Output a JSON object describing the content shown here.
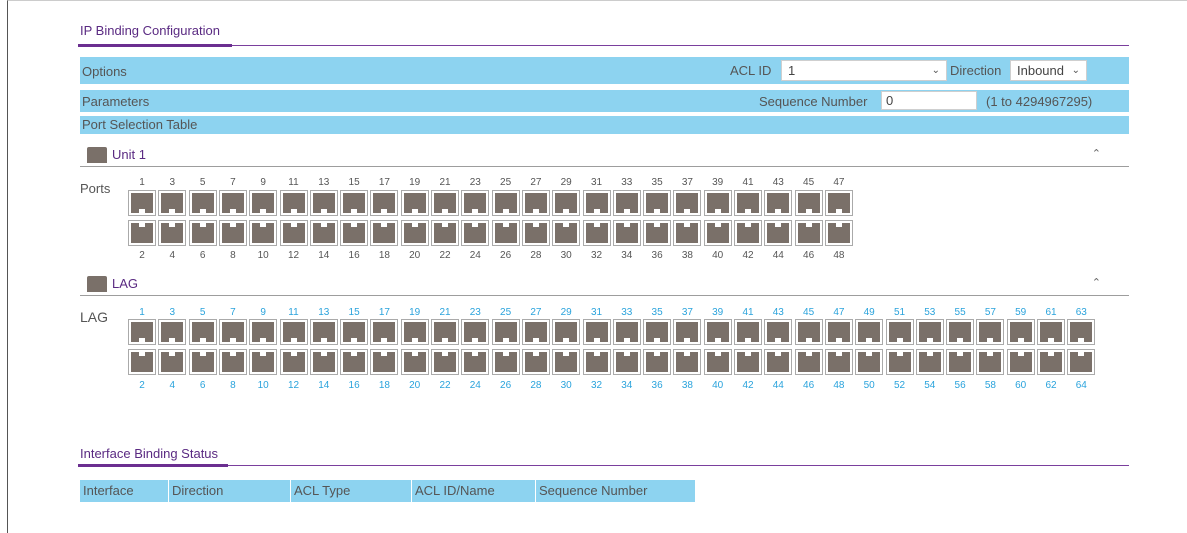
{
  "config_title": "IP Binding Configuration",
  "options": {
    "label": "Options",
    "acl_id_label": "ACL ID",
    "acl_id_value": "1",
    "direction_label": "Direction",
    "direction_value": "Inbound"
  },
  "parameters": {
    "label": "Parameters",
    "sequence_label": "Sequence Number",
    "sequence_value": "0",
    "sequence_range": "(1 to 4294967295)"
  },
  "port_selection_label": "Port Selection Table",
  "unit": {
    "label": "Unit 1",
    "ports_label": "Ports",
    "odd": [
      "1",
      "3",
      "5",
      "7",
      "9",
      "11",
      "13",
      "15",
      "17",
      "19",
      "21",
      "23",
      "25",
      "27",
      "29",
      "31",
      "33",
      "35",
      "37",
      "39",
      "41",
      "43",
      "45",
      "47"
    ],
    "even": [
      "2",
      "4",
      "6",
      "8",
      "10",
      "12",
      "14",
      "16",
      "18",
      "20",
      "22",
      "24",
      "26",
      "28",
      "30",
      "32",
      "34",
      "36",
      "38",
      "40",
      "42",
      "44",
      "46",
      "48"
    ]
  },
  "lag": {
    "label": "LAG",
    "row_label": "LAG",
    "odd": [
      "1",
      "3",
      "5",
      "7",
      "9",
      "11",
      "13",
      "15",
      "17",
      "19",
      "21",
      "23",
      "25",
      "27",
      "29",
      "31",
      "33",
      "35",
      "37",
      "39",
      "41",
      "43",
      "45",
      "47",
      "49",
      "51",
      "53",
      "55",
      "57",
      "59",
      "61",
      "63"
    ],
    "even": [
      "2",
      "4",
      "6",
      "8",
      "10",
      "12",
      "14",
      "16",
      "18",
      "20",
      "22",
      "24",
      "26",
      "28",
      "30",
      "32",
      "34",
      "36",
      "38",
      "40",
      "42",
      "44",
      "46",
      "48",
      "50",
      "52",
      "54",
      "56",
      "58",
      "60",
      "62",
      "64"
    ]
  },
  "status_title": "Interface Binding Status",
  "status_columns": [
    "Interface",
    "Direction",
    "ACL Type",
    "ACL ID/Name",
    "Sequence Number"
  ],
  "colors": {
    "header_bar": "#8dd3f0",
    "accent": "#6b2f90",
    "port": "#7a7069",
    "lag_number": "#2aa3dc"
  },
  "icons": {
    "collapse": "chevron-up-icon",
    "dropdown": "chevron-down-icon",
    "unit": "unit-icon"
  }
}
